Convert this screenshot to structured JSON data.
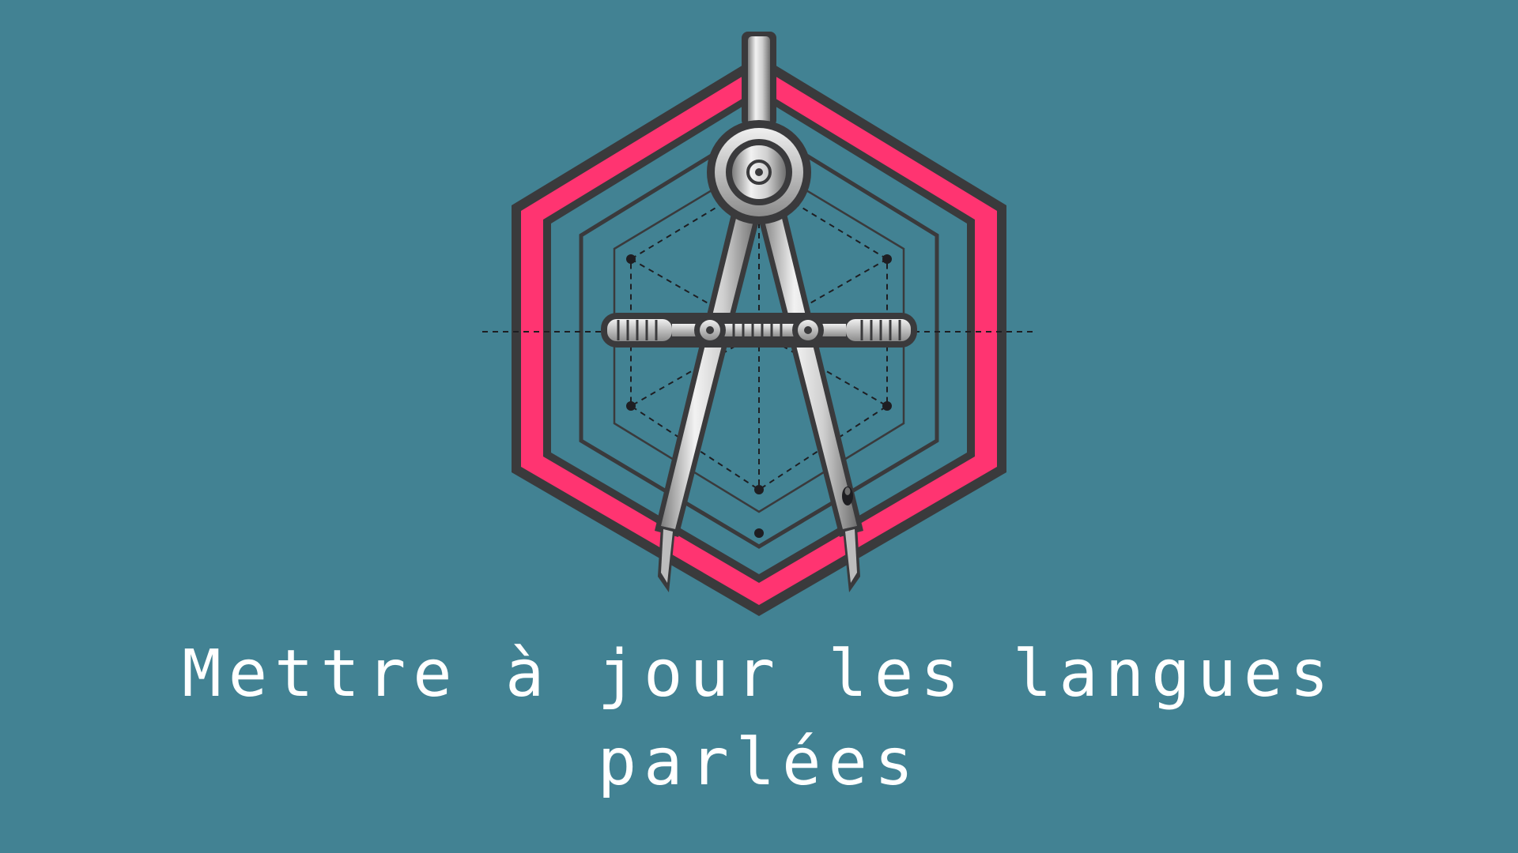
{
  "title": {
    "line1": "Mettre à jour les langues",
    "line2": "parlées"
  },
  "colors": {
    "background": "#428293",
    "hexagon_fill": "#ff3471",
    "outline": "#3a3a3c",
    "metal_light": "#e6e6e6",
    "metal_dark": "#8a8a8a",
    "text": "#ffffff"
  },
  "icons": {
    "emblem": "drawing-compass-in-hexagon-icon"
  }
}
